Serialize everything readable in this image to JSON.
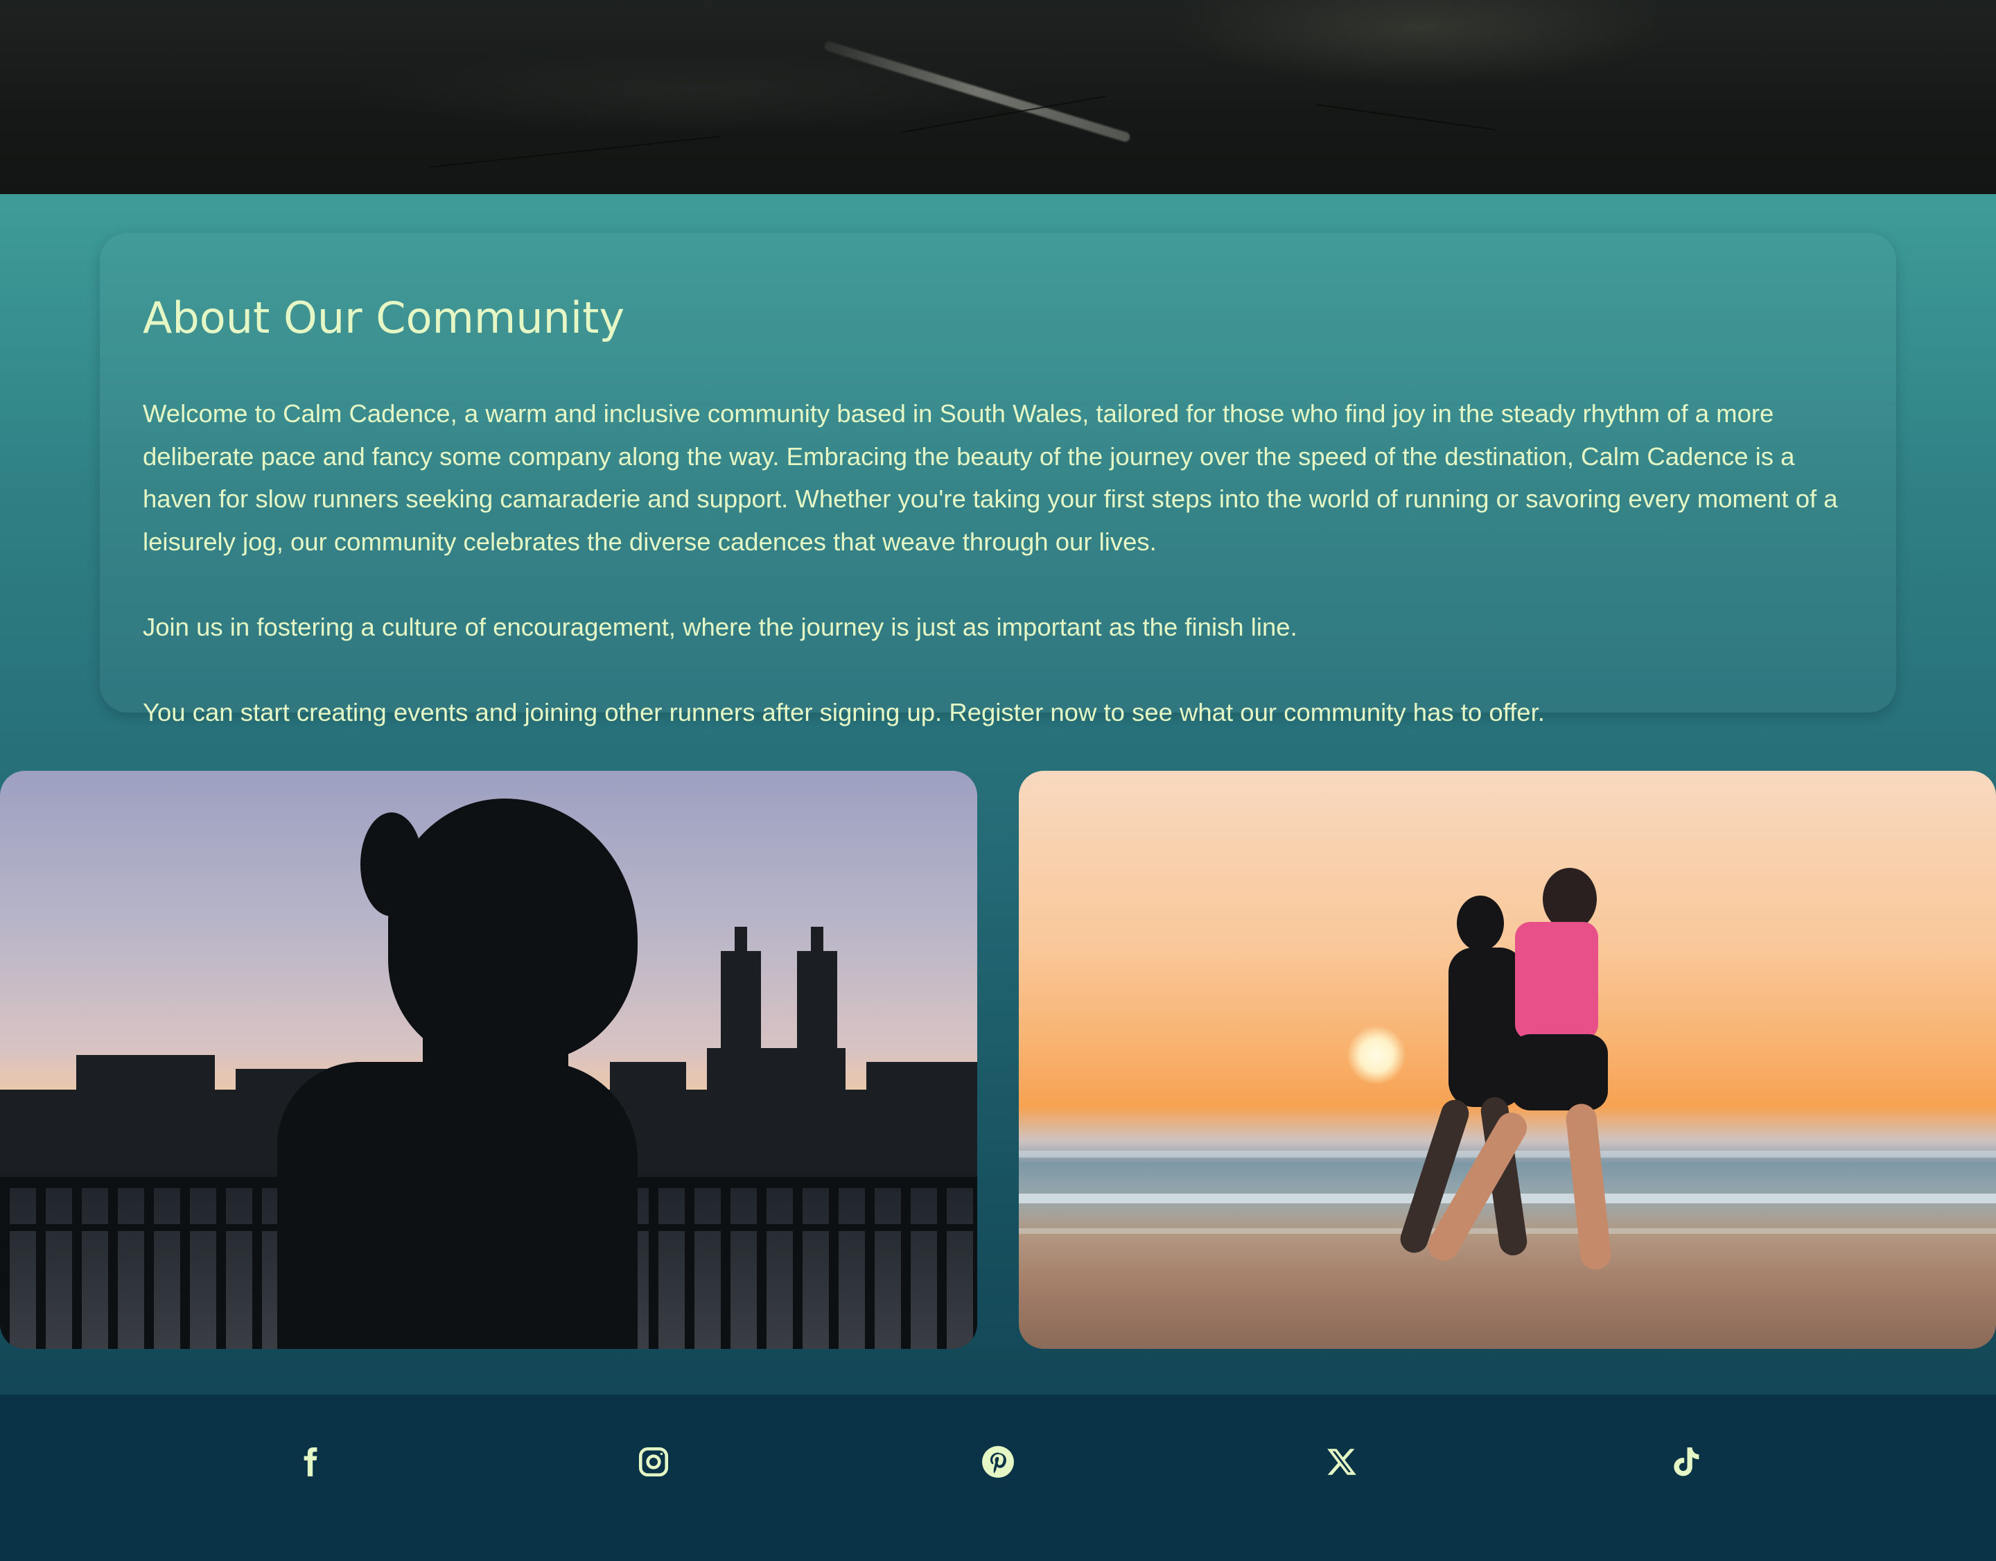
{
  "about": {
    "title": "About Our Community",
    "paragraphs": [
      "Welcome to Calm Cadence, a warm and inclusive community based in South Wales, tailored for those who find joy in the steady rhythm of a more deliberate pace and fancy some company along the way. Embracing the beauty of the journey over the speed of the destination, Calm Cadence is a haven for slow runners seeking camaraderie and support. Whether you're taking your first steps into the world of running or savoring every moment of a leisurely jog, our community celebrates the diverse cadences that weave through our lives.",
      "Join us in fostering a culture of encouragement, where the journey is just as important as the finish line.",
      "You can start creating events and joining other runners after signing up. Register now to see what our community has to offer."
    ]
  },
  "images": {
    "hero": "road-photo",
    "left": "runner-silhouette-city-skyline-photo",
    "right": "two-runners-beach-sunset-photo"
  },
  "footer": {
    "social": [
      {
        "name": "facebook",
        "icon": "facebook-icon"
      },
      {
        "name": "instagram",
        "icon": "instagram-icon"
      },
      {
        "name": "pinterest",
        "icon": "pinterest-icon"
      },
      {
        "name": "x",
        "icon": "x-icon"
      },
      {
        "name": "tiktok",
        "icon": "tiktok-icon"
      }
    ]
  },
  "colors": {
    "text": "#e6f7c6",
    "footer_bg": "#0a3347",
    "gradient_top": "#3e9c98",
    "gradient_bottom": "#134757"
  }
}
